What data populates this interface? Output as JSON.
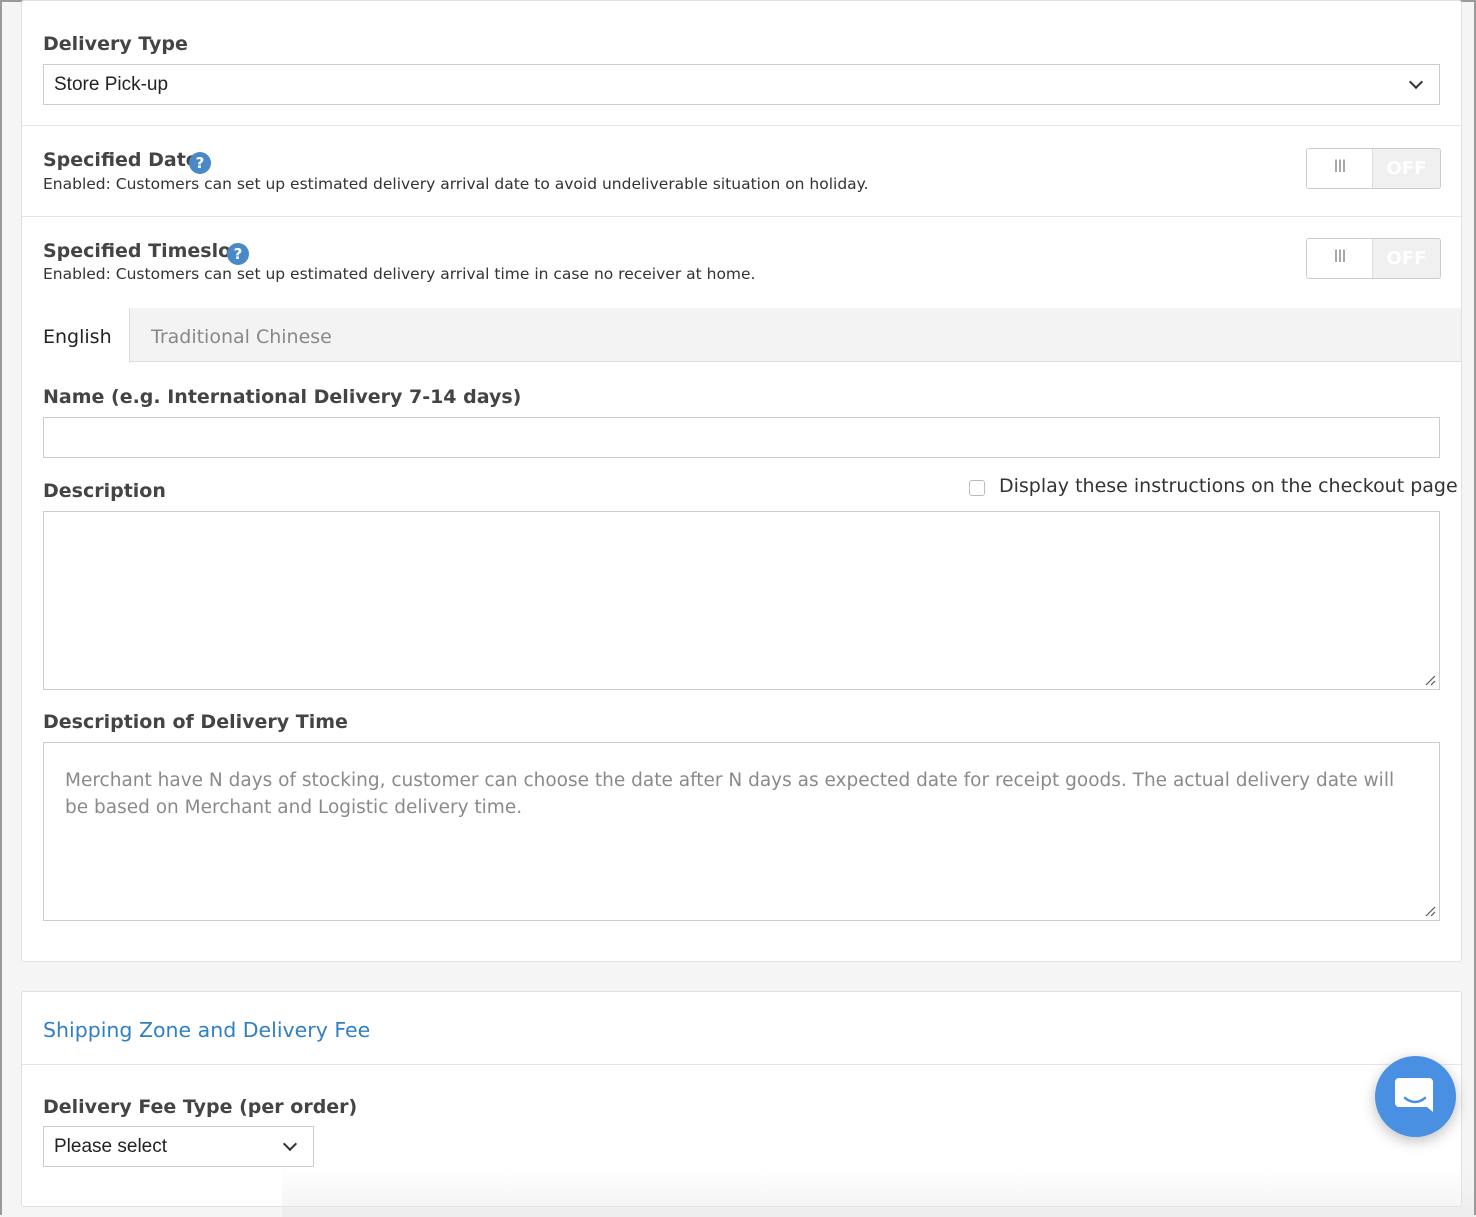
{
  "delivery_type": {
    "label": "Delivery Type",
    "selected": "Store Pick-up"
  },
  "specified_date": {
    "label": "Specified Date",
    "help": "?",
    "hint": "Enabled: Customers can set up estimated delivery arrival date to avoid undeliverable situation on holiday.",
    "toggle_handle": "III",
    "toggle_state": "OFF"
  },
  "specified_timeslot": {
    "label": "Specified Timeslot",
    "help": "?",
    "hint": "Enabled: Customers can set up estimated delivery arrival time in case no receiver at home.",
    "toggle_handle": "III",
    "toggle_state": "OFF"
  },
  "language_tabs": [
    {
      "label": "English",
      "active": true
    },
    {
      "label": "Traditional Chinese",
      "active": false
    }
  ],
  "name_field": {
    "label": "Name (e.g. International Delivery 7-14 days)",
    "value": ""
  },
  "description_field": {
    "label": "Description",
    "value": "",
    "checkbox_label": "Display these instructions on the checkout page",
    "checkbox_checked": false
  },
  "delivery_time_field": {
    "label": "Description of Delivery Time",
    "placeholder": "Merchant have N days of stocking, customer can choose the  date after N days as expected date for receipt goods. The actual delivery date will be based on Merchant and Logistic delivery time."
  },
  "shipping_zone": {
    "title": "Shipping Zone and Delivery Fee",
    "fee_type_label": "Delivery Fee Type (per order)",
    "fee_type_selected": "Please select"
  },
  "colors": {
    "accent": "#2f7fc4",
    "help_icon": "#4a89c8",
    "chat_button": "#4a90e2"
  },
  "icons": {
    "help": "question-circle-icon",
    "dropdown": "chevron-down-icon",
    "chat": "chat-bubble-icon",
    "resize": "resize-handle-icon"
  }
}
